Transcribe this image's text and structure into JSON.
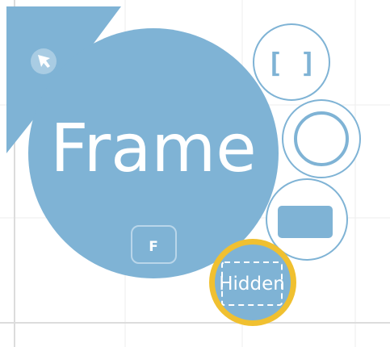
{
  "menu": {
    "center": {
      "label": "Frame",
      "shortcut_key": "F",
      "icon": "cursor-arrow-icon"
    },
    "options": [
      {
        "name": "bracket-frame",
        "label": "[ ]",
        "icon": "bracket-frame-icon"
      },
      {
        "name": "circle-frame",
        "label": "",
        "icon": "circle-outline-icon"
      },
      {
        "name": "rectangle-frame",
        "label": "",
        "icon": "filled-rectangle-icon"
      },
      {
        "name": "hidden-frame",
        "label": "Hidden",
        "icon": "dashed-box-icon",
        "selected": true
      }
    ]
  },
  "colors": {
    "primary": "#7fb3d5",
    "option_border": "#7fb3d5",
    "selected_ring": "#f0c030",
    "text": "#ffffff",
    "grid": "#ececec",
    "axis": "#dcdcdc"
  }
}
